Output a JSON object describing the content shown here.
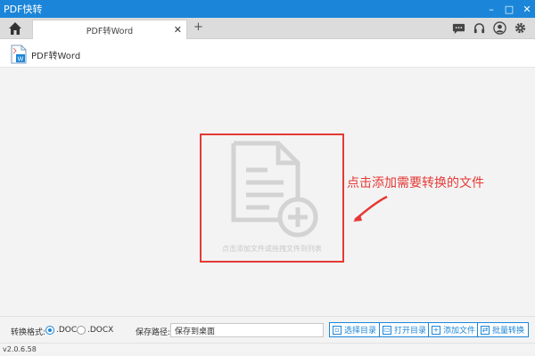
{
  "app": {
    "title": "PDF快转"
  },
  "window_controls": {
    "minimize": "–",
    "maximize": "□",
    "close": "✕"
  },
  "tabs": [
    {
      "label": "PDF转Word",
      "close": "✕"
    }
  ],
  "tab_add": "+",
  "header": {
    "title": "PDF转Word"
  },
  "drop_zone": {
    "hint": "点击添加文件或拖拽文件到列表"
  },
  "annotation": {
    "text": "点击添加需要转换的文件"
  },
  "format": {
    "label": "转换格式:",
    "options": [
      ".DOC",
      ".DOCX"
    ],
    "selected": ".DOC"
  },
  "save_path": {
    "label": "保存路径:",
    "value": "保存到桌面"
  },
  "buttons": {
    "choose_dir": "选择目录",
    "open_dir": "打开目录",
    "add_file": "添加文件",
    "batch_convert": "批量转换"
  },
  "status": {
    "version": "v2.0.6.58"
  },
  "colors": {
    "accent": "#1b86d9",
    "annotation": "#e53935",
    "icon_gray": "#d3d3d3"
  }
}
